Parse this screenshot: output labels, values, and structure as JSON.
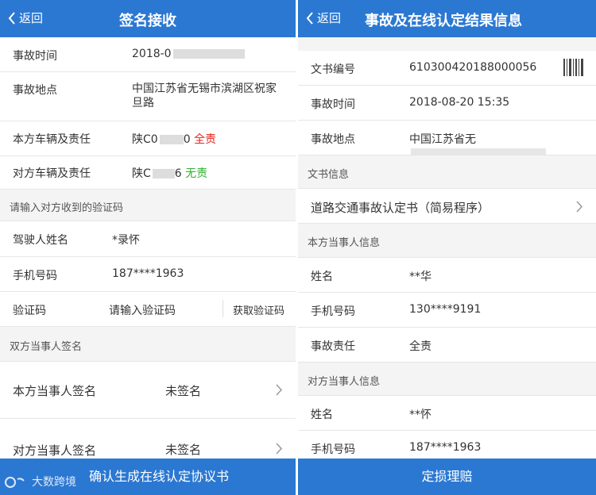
{
  "left": {
    "back_label": "返回",
    "title": "签名接收",
    "rows": [
      {
        "label": "事故时间",
        "value": "2018-0"
      },
      {
        "label": "事故地点",
        "value": "中国江苏省无锡市滨湖区祝家旦路"
      },
      {
        "label": "本方车辆及责任",
        "value_prefix": "陕C0",
        "value_suffix": "0",
        "status": "全责"
      },
      {
        "label": "对方车辆及责任",
        "value_prefix": "陕C",
        "value_suffix": "6",
        "status": "无责"
      }
    ],
    "section_code": "请输入对方收到的验证码",
    "driver": {
      "label": "驾驶人姓名",
      "value": "*录怀"
    },
    "phone": {
      "label": "手机号码",
      "value": "187****1963"
    },
    "code": {
      "label": "验证码",
      "placeholder": "请输入验证码",
      "action": "获取验证码"
    },
    "section_sign": "双方当事人签名",
    "sign_self": {
      "label": "本方当事人签名",
      "value": "未签名"
    },
    "sign_other": {
      "label": "对方当事人签名",
      "value": "未签名"
    },
    "footer": "确认生成在线认定协议书",
    "watermark": "大数跨境"
  },
  "right": {
    "back_label": "返回",
    "title": "事故及在线认定结果信息",
    "doc_number": {
      "label": "文书编号",
      "value": "610300420188000056"
    },
    "time": {
      "label": "事故时间",
      "value": "2018-08-20 15:35"
    },
    "place": {
      "label": "事故地点",
      "value": "中国江苏省无"
    },
    "section_doc": "文书信息",
    "doc_link": "道路交通事故认定书（简易程序）",
    "section_self": "本方当事人信息",
    "self_name": {
      "label": "姓名",
      "value": "**华"
    },
    "self_phone": {
      "label": "手机号码",
      "value": "130****9191"
    },
    "self_resp": {
      "label": "事故责任",
      "value": "全责"
    },
    "section_other": "对方当事人信息",
    "other_name": {
      "label": "姓名",
      "value": "**怀"
    },
    "other_phone": {
      "label": "手机号码",
      "value": "187****1963"
    },
    "footer": "定损理赔"
  },
  "colors": {
    "primary": "#2b78d2",
    "danger": "#e8231e",
    "success": "#2fb12f"
  }
}
